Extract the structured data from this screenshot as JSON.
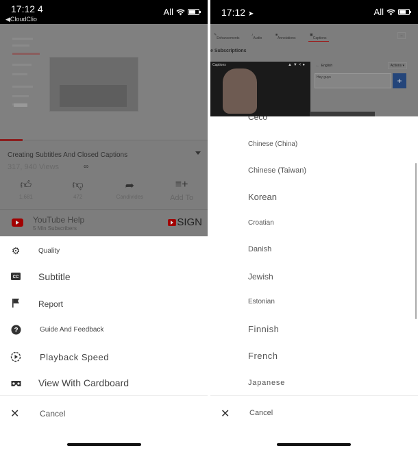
{
  "left": {
    "status": {
      "time": "17:12 4",
      "back_label": "CloudClio",
      "carrier": "All"
    },
    "video": {
      "title": "Creating Subtitles And Closed Captions",
      "views": "317, 940 Views",
      "actions": [
        {
          "icon": "thumbs-up-icon",
          "label": "1,681"
        },
        {
          "icon": "thumbs-down-icon",
          "label": "472"
        },
        {
          "icon": "share-icon",
          "label": "Candivides"
        },
        {
          "icon": "add-to-playlist-icon",
          "label": "Add To"
        }
      ],
      "channel_name": "YouTube Help",
      "channel_subs": "5 Mln Subscribers",
      "subscribe_label": "SIGN",
      "progress_percent": 11
    },
    "menu": {
      "items": [
        {
          "icon": "gear-icon",
          "label": "Quality"
        },
        {
          "icon": "closed-captions-icon",
          "label": "Subtitle"
        },
        {
          "icon": "flag-icon",
          "label": "Report"
        },
        {
          "icon": "help-icon",
          "label": "Guide And Feedback"
        },
        {
          "icon": "playback-speed-icon",
          "label": "Playback Speed"
        },
        {
          "icon": "cardboard-icon",
          "label": "View With Cardboard"
        }
      ],
      "cancel_label": "Cancel"
    }
  },
  "right": {
    "status": {
      "time": "17:12",
      "carrier": "All"
    },
    "editor": {
      "tabs": [
        "Enhancements",
        "Audio",
        "Annotations",
        "Captions"
      ],
      "active_tab": "Captions",
      "heading": "e Subscriptions",
      "video_label": "Captions",
      "language": "English",
      "actions_label": "Actions",
      "caption_text": "Hey guys",
      "add_button": "+"
    },
    "languages": [
      "Ceco",
      "Chinese (China)",
      "Chinese (Taiwan)",
      "Korean",
      "Croatian",
      "Danish",
      "Jewish",
      "Estonian",
      "Finnish",
      "French",
      "Japanese"
    ],
    "cancel_label": "Cancel"
  }
}
